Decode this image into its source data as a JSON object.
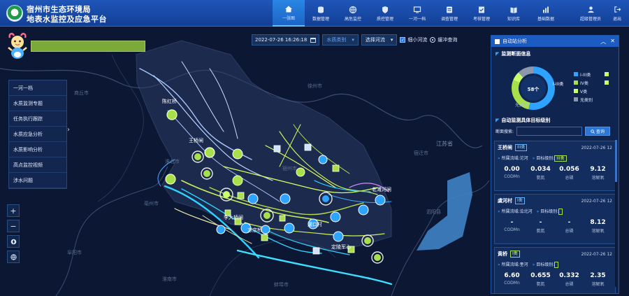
{
  "header": {
    "title_line1": "宿州市生态环境局",
    "title_line2": "地表水监控及应急平台",
    "nav": [
      {
        "label": "一张图",
        "icon": "home-icon",
        "active": true
      },
      {
        "label": "数据管理",
        "icon": "database-icon",
        "active": false
      },
      {
        "label": "高危监控",
        "icon": "globe-icon",
        "active": false
      },
      {
        "label": "质控管理",
        "icon": "shield-icon",
        "active": false
      },
      {
        "label": "一河一档",
        "icon": "monitor-icon",
        "active": false
      },
      {
        "label": "调查管理",
        "icon": "survey-icon",
        "active": false
      },
      {
        "label": "考核管理",
        "icon": "assessment-icon",
        "active": false
      },
      {
        "label": "知识库",
        "icon": "book-icon",
        "active": false
      },
      {
        "label": "基础数据",
        "icon": "chart-icon",
        "active": false
      }
    ],
    "user_label": "超级管理员",
    "logout_label": "退出"
  },
  "toolbar": {
    "datetime": "2022-07-26 16:26:18",
    "water_category": "水质类别",
    "select_river": "选择河流",
    "small_river_label": "细小河流",
    "buffer_label": "缓冲查询"
  },
  "left_menu": [
    "一河一档",
    "水质监测专题",
    "任务执行跟踪",
    "水质应急分析",
    "水质影响分析",
    "高点监控视频",
    "涉水问题"
  ],
  "map_labels": {
    "province": "江苏省",
    "cities": [
      "商丘市",
      "淮北市",
      "宿州市",
      "徐州市",
      "蚌埠市",
      "宿迁市",
      "亳州市",
      "阜阳市",
      "淮南市",
      "泗阳县"
    ],
    "stations": [
      "陈红桥",
      "王桥闸",
      "虞河村",
      "黄桥",
      "方店桥",
      "定陵军心",
      "团结闸",
      "老濉河闸",
      "李大桥闸",
      "草屯",
      "灌口村",
      "宝田"
    ]
  },
  "panel": {
    "title": "自动站分析",
    "section1_title": "监测断面信息",
    "donut": {
      "center_value": "58个",
      "legend": [
        {
          "label": "I-III类",
          "color": "#2ea3ff",
          "value": 31
        },
        {
          "label": "IV类",
          "color": "#a8e04b",
          "value": 16
        },
        {
          "label": "V类",
          "color": "#c8ff6b",
          "value": 4
        },
        {
          "label": "无类别",
          "color": "#8d98ad",
          "value": 7
        }
      ],
      "callout_top": "I-III类",
      "callout_bottom": "无类别"
    },
    "section2_title": "自动监测具体目标级别",
    "search_label": "断面搜索:",
    "search_placeholder": "",
    "search_button": "查询",
    "cards": [
      {
        "name": "王桥闸",
        "class": "III类",
        "class_color": "blue",
        "time": "2022-07-26 12",
        "basin": "沱河",
        "target": "III类",
        "values": [
          {
            "v": "0.00",
            "k": "CODMn"
          },
          {
            "v": "0.034",
            "k": "氨氮"
          },
          {
            "v": "0.056",
            "k": "总磷"
          },
          {
            "v": "9.12",
            "k": "溶解氧"
          }
        ]
      },
      {
        "name": "虞河村",
        "class": "I类",
        "class_color": "blue",
        "time": "2022-07-26 12",
        "basin": "浍北河",
        "target": "",
        "values": [
          {
            "v": "-",
            "k": "CODMn"
          },
          {
            "v": "-",
            "k": "氨氮"
          },
          {
            "v": "-",
            "k": "总磷"
          },
          {
            "v": "8.12",
            "k": "溶解氧"
          }
        ]
      },
      {
        "name": "黄桥",
        "class": "I类",
        "class_color": "green",
        "time": "2022-07-26 12",
        "basin": "奎河",
        "target": "",
        "values": [
          {
            "v": "6.60",
            "k": "CODMn"
          },
          {
            "v": "0.655",
            "k": "氨氮"
          },
          {
            "v": "0.332",
            "k": "总磷"
          },
          {
            "v": "2.35",
            "k": "溶解氧"
          }
        ]
      }
    ],
    "basin_prefix": "所属流域:",
    "target_prefix": "目标级别:"
  }
}
